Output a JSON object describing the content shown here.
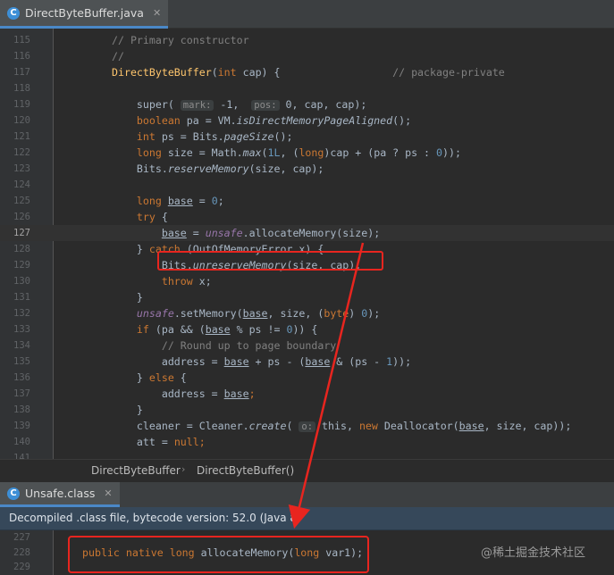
{
  "top_tab": {
    "label": "DirectByteBuffer.java",
    "icon": "java-class-icon",
    "close": "✕"
  },
  "code_lines": [
    {
      "num": "115",
      "segs": [
        [
          "cm",
          "// Primary constructor"
        ]
      ]
    },
    {
      "num": "116",
      "segs": [
        [
          "cm",
          "//"
        ]
      ]
    },
    {
      "num": "117",
      "segs": [
        [
          "fn",
          "DirectByteBuffer"
        ],
        [
          "",
          "("
        ],
        [
          "kw",
          "int"
        ],
        [
          "",
          " cap) {                  "
        ],
        [
          "cm",
          "// package-private"
        ]
      ]
    },
    {
      "num": "118",
      "segs": []
    },
    {
      "num": "119",
      "segs": [
        [
          "",
          "    super( "
        ],
        [
          "hint",
          "mark:"
        ],
        [
          "",
          " -1,  "
        ],
        [
          "hint",
          "pos:"
        ],
        [
          "",
          " 0, cap, cap);"
        ]
      ]
    },
    {
      "num": "120",
      "segs": [
        [
          "kw",
          "    boolean"
        ],
        [
          "",
          " pa = VM."
        ],
        [
          "it",
          "isDirectMemoryPageAligned"
        ],
        [
          "",
          "();"
        ]
      ]
    },
    {
      "num": "121",
      "segs": [
        [
          "kw",
          "    int"
        ],
        [
          "",
          " ps = Bits."
        ],
        [
          "it",
          "pageSize"
        ],
        [
          "",
          "();"
        ]
      ]
    },
    {
      "num": "122",
      "segs": [
        [
          "kw",
          "    long"
        ],
        [
          "",
          " size = Math."
        ],
        [
          "it",
          "max"
        ],
        [
          "",
          "("
        ],
        [
          "num",
          "1L"
        ],
        [
          "",
          ", ("
        ],
        [
          "kw",
          "long"
        ],
        [
          "",
          ")cap + (pa ? ps : "
        ],
        [
          "num",
          "0"
        ],
        [
          "",
          "));"
        ]
      ]
    },
    {
      "num": "123",
      "segs": [
        [
          "",
          "    Bits."
        ],
        [
          "it",
          "reserveMemory"
        ],
        [
          "",
          "(size, cap);"
        ]
      ]
    },
    {
      "num": "124",
      "segs": []
    },
    {
      "num": "125",
      "segs": [
        [
          "kw",
          "    long"
        ],
        [
          "",
          " "
        ],
        [
          "ul",
          "base"
        ],
        [
          "",
          " = "
        ],
        [
          "num",
          "0"
        ],
        [
          "",
          ";"
        ]
      ]
    },
    {
      "num": "126",
      "segs": [
        [
          "kw",
          "    try"
        ],
        [
          "",
          " {"
        ]
      ]
    },
    {
      "num": "127",
      "segs": [
        [
          "",
          "        "
        ],
        [
          "ul",
          "base"
        ],
        [
          "",
          " = "
        ],
        [
          "st",
          "unsafe"
        ],
        [
          "",
          ".allocateMemory(size);"
        ]
      ]
    },
    {
      "num": "128",
      "segs": [
        [
          "",
          "    } "
        ],
        [
          "kw",
          "catch"
        ],
        [
          "",
          " (OutOfMemoryError x) {"
        ]
      ]
    },
    {
      "num": "129",
      "segs": [
        [
          "",
          "        Bits."
        ],
        [
          "it",
          "unreserveMemory"
        ],
        [
          "",
          "(size, cap);"
        ]
      ]
    },
    {
      "num": "130",
      "segs": [
        [
          "kw",
          "        throw"
        ],
        [
          "",
          " x;"
        ]
      ]
    },
    {
      "num": "131",
      "segs": [
        [
          "",
          "    }"
        ]
      ]
    },
    {
      "num": "132",
      "segs": [
        [
          "st",
          "    unsafe"
        ],
        [
          "",
          ".setMemory("
        ],
        [
          "ul",
          "base"
        ],
        [
          "",
          ", size, ("
        ],
        [
          "kw",
          "byte"
        ],
        [
          "",
          ") "
        ],
        [
          "num",
          "0"
        ],
        [
          "",
          ");"
        ]
      ]
    },
    {
      "num": "133",
      "segs": [
        [
          "kw",
          "    if"
        ],
        [
          "",
          " (pa && ("
        ],
        [
          "ul",
          "base"
        ],
        [
          "",
          " % ps != "
        ],
        [
          "num",
          "0"
        ],
        [
          "",
          ")) {"
        ]
      ]
    },
    {
      "num": "134",
      "segs": [
        [
          "cm",
          "        // Round up to page boundary"
        ]
      ]
    },
    {
      "num": "135",
      "segs": [
        [
          "",
          "        address = "
        ],
        [
          "ul",
          "base"
        ],
        [
          "",
          " + ps - ("
        ],
        [
          "ul",
          "base"
        ],
        [
          "",
          " & (ps - "
        ],
        [
          "num",
          "1"
        ],
        [
          "",
          "));"
        ]
      ]
    },
    {
      "num": "136",
      "segs": [
        [
          "",
          "    } "
        ],
        [
          "kw",
          "else"
        ],
        [
          "",
          " {"
        ]
      ]
    },
    {
      "num": "137",
      "segs": [
        [
          "",
          "        address = "
        ],
        [
          "ul",
          "base"
        ],
        [
          "kw",
          ";"
        ]
      ]
    },
    {
      "num": "138",
      "segs": [
        [
          "",
          "    }"
        ]
      ]
    },
    {
      "num": "139",
      "segs": [
        [
          "",
          "    cleaner = Cleaner."
        ],
        [
          "it",
          "create"
        ],
        [
          "",
          "( "
        ],
        [
          "hint",
          "o:"
        ],
        [
          "",
          " this, "
        ],
        [
          "kw",
          "new"
        ],
        [
          "",
          " Deallocator("
        ],
        [
          "ul",
          "base"
        ],
        [
          "",
          ", size, cap));"
        ]
      ]
    },
    {
      "num": "140",
      "segs": [
        [
          "",
          "    att = "
        ],
        [
          "kw",
          "null"
        ],
        [
          "kw",
          ";"
        ]
      ]
    },
    {
      "num": "141",
      "segs": []
    }
  ],
  "breadcrumb": {
    "item1": "DirectByteBuffer",
    "separator": "›",
    "item2": "DirectByteBuffer()"
  },
  "bottom_tab": {
    "label": "Unsafe.class",
    "icon": "class-file-icon",
    "close": "✕"
  },
  "banner_text": "Decompiled .class file, bytecode version: 52.0 (Java 8)",
  "bottom_lines": [
    {
      "num": "227",
      "segs": []
    },
    {
      "num": "228",
      "segs": [
        [
          "kw",
          "public native long"
        ],
        [
          "",
          " allocateMemory("
        ],
        [
          "kw",
          "long"
        ],
        [
          "",
          " var1);"
        ]
      ]
    },
    {
      "num": "229",
      "segs": []
    }
  ],
  "watermark": "@稀土掘金技术社区",
  "colors": {
    "highlight_box": "#e8251f",
    "keyword": "#cc7832",
    "comment": "#808080",
    "number": "#6897bb",
    "field": "#9876aa"
  }
}
